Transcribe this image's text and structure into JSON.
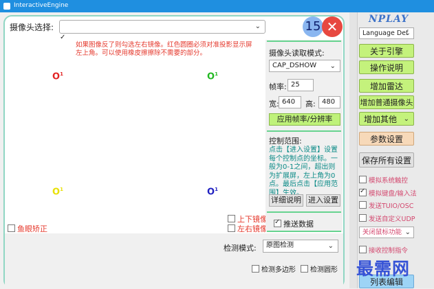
{
  "window": {
    "title": "InteractiveEngine"
  },
  "top": {
    "camera_label": "摄像头选择:",
    "camera_value": "",
    "camera_check": "✓",
    "counter": "15",
    "close_glyph": "✕"
  },
  "preview": {
    "warning": "如果图像反了则勾选左右镜像。红色圆圈必须对准投影显示屏左上角。可以使用橡皮擦擦除不需要的部分。",
    "markers": [
      {
        "glyph": "O",
        "sup": "1",
        "color": "#e22222"
      },
      {
        "glyph": "O",
        "sup": "1",
        "color": "#22b822"
      },
      {
        "glyph": "O",
        "sup": "1",
        "color": "#e8e000"
      },
      {
        "glyph": "O",
        "sup": "1",
        "color": "#2020c0"
      }
    ],
    "fisheye": "鱼眼矫正",
    "flip_v": "上下镜像",
    "flip_h": "左右镜像"
  },
  "camera_settings": {
    "read_mode_label": "摄像头读取模式:",
    "read_mode_value": "CAP_DSHOW",
    "fps_label": "帧率:",
    "fps_value": "25",
    "width_label": "宽:",
    "width_value": "640",
    "height_label": "高:",
    "height_value": "480",
    "apply_button": "应用帧率/分辨率"
  },
  "control_range": {
    "label": "控制范围:",
    "help": "点击【进入设置】设置每个控制点的坐标。一般为0-1之间，超出则为扩展屏，左上角为0点。最后点击【应用范围】生效。",
    "details_button": "详细说明",
    "enter_button": "进入设置",
    "push_data": "推送数据"
  },
  "detection": {
    "mode_label": "检测模式:",
    "mode_value": "原图检测",
    "polygon": "检测多边形",
    "circle": "检测圆形"
  },
  "sidebar": {
    "logo": "NPLAY",
    "language": "Language Def",
    "buttons": {
      "about": "关于引擎",
      "guide": "操作说明",
      "add_radar": "增加雷达",
      "add_camera": "增加普通摄像头",
      "add_other": "增加其他",
      "params": "参数设置",
      "save_all": "保存所有设置",
      "mouse_func": "关闭鼠标功能",
      "list_edit": "列表编辑"
    },
    "checks": {
      "sim_touch": "模拟系统触控",
      "sim_keyboard": "模拟键盘/输入法",
      "send_tuio": "发送TUIO/OSC",
      "send_udp": "发送自定义UDP",
      "recv_ctrl": "接收控制指令"
    }
  },
  "watermark": "最需网"
}
